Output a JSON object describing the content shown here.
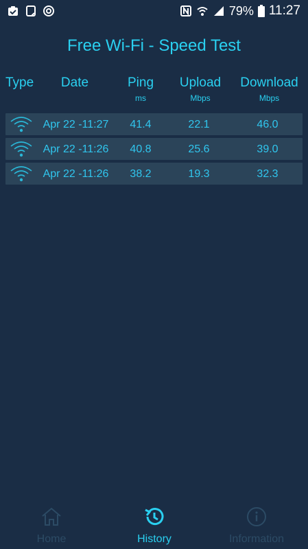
{
  "status_bar": {
    "battery": "79%",
    "time": "11:27"
  },
  "app": {
    "title": "Free Wi-Fi - Speed Test"
  },
  "table": {
    "headers": [
      {
        "label": "Type",
        "unit": ""
      },
      {
        "label": "Date",
        "unit": ""
      },
      {
        "label": "Ping",
        "unit": "ms"
      },
      {
        "label": "Upload",
        "unit": "Mbps"
      },
      {
        "label": "Download",
        "unit": "Mbps"
      }
    ],
    "rows": [
      {
        "date": "Apr 22 -11:27",
        "ping": "41.4",
        "upload": "22.1",
        "download": "46.0"
      },
      {
        "date": "Apr 22 -11:26",
        "ping": "40.8",
        "upload": "25.6",
        "download": "39.0"
      },
      {
        "date": "Apr 22 -11:26",
        "ping": "38.2",
        "upload": "19.3",
        "download": "32.3"
      }
    ]
  },
  "nav": {
    "items": [
      {
        "label": "Home",
        "icon": "home-icon",
        "active": false
      },
      {
        "label": "History",
        "icon": "history-icon",
        "active": true
      },
      {
        "label": "Information",
        "icon": "info-icon",
        "active": false
      }
    ]
  },
  "colors": {
    "background": "#1a2d45",
    "accent": "#2ad0f0",
    "row": "#2b4459",
    "inactive": "#2c4b65"
  }
}
